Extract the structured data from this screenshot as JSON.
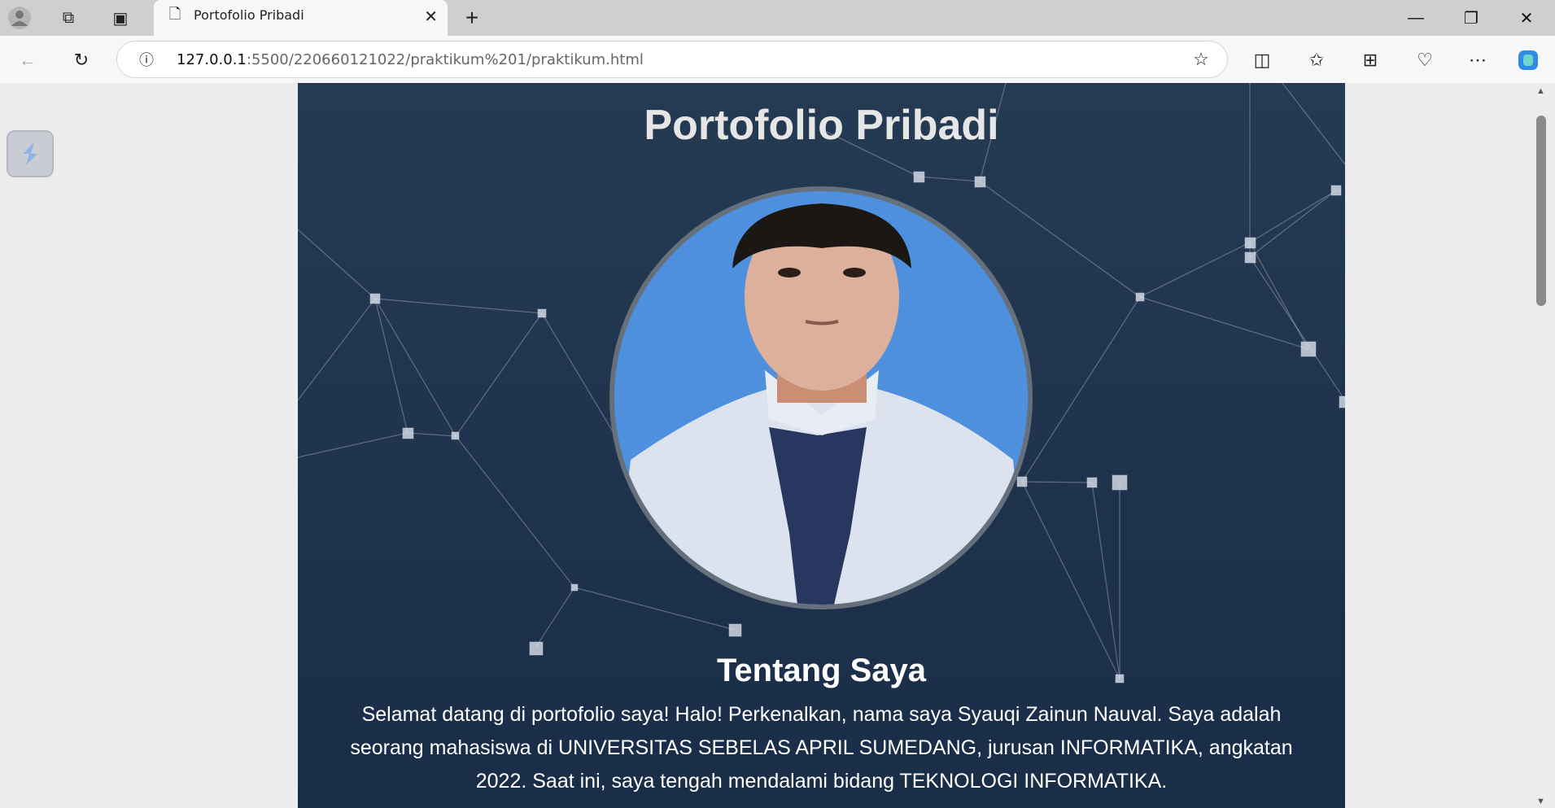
{
  "browser": {
    "tab_title": "Portofolio Pribadi",
    "url_host": "127.0.0.1",
    "url_rest": ":5500/220660121022/praktikum%201/praktikum.html"
  },
  "page": {
    "title": "Portofolio Pribadi",
    "about_heading": "Tentang Saya",
    "about_text": "Selamat datang di portofolio saya! Halo! Perkenalkan, nama saya Syauqi Zainun Nauval. Saya adalah seorang mahasiswa di UNIVERSITAS SEBELAS APRIL SUMEDANG, jurusan INFORMATIKA, angkatan 2022. Saat ini, saya tengah mendalami bidang TEKNOLOGI INFORMATIKA."
  }
}
